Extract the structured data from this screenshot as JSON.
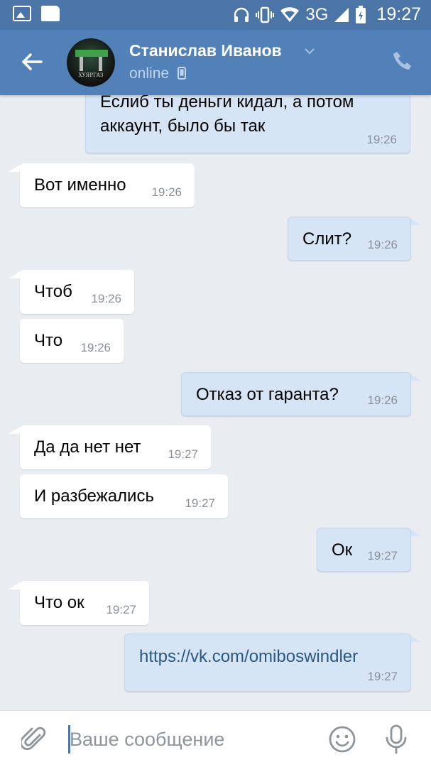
{
  "status_bar": {
    "time": "19:27",
    "network": "3G",
    "icons": [
      "image-icon",
      "document-icon",
      "headphones-icon",
      "vibrate-icon",
      "wifi-icon",
      "signal-icon",
      "battery-charging-icon"
    ]
  },
  "header": {
    "contact_name": "Станислав Иванов",
    "status": "online",
    "icons": [
      "back-arrow-icon",
      "avatar",
      "chevron-down-icon",
      "mobile-icon",
      "phone-icon"
    ]
  },
  "messages": [
    {
      "dir": "out",
      "text": "Еслиб ты деньги кидал, а потом\nаккаунт, было бы так",
      "time": "19:26"
    },
    {
      "dir": "in",
      "text": "Вот именно",
      "time": "19:26"
    },
    {
      "dir": "out",
      "text": "Слит?",
      "time": "19:26"
    },
    {
      "dir": "in",
      "text": "Чтоб",
      "time": "19:26"
    },
    {
      "dir": "in",
      "text": "Что",
      "time": "19:26"
    },
    {
      "dir": "out",
      "text": "Отказ от гаранта?",
      "time": "19:26"
    },
    {
      "dir": "in",
      "text": "Да да нет нет",
      "time": "19:27"
    },
    {
      "dir": "in",
      "text": "И разбежались",
      "time": "19:27"
    },
    {
      "dir": "out",
      "text": "Ок",
      "time": "19:27"
    },
    {
      "dir": "in",
      "text": "Что ок",
      "time": "19:27"
    },
    {
      "dir": "out",
      "text": "https://vk.com/omiboswindler",
      "time": "19:27",
      "link": true
    }
  ],
  "composer": {
    "placeholder": "Ваше сообщение",
    "icons": [
      "paperclip-icon",
      "smile-icon",
      "microphone-icon"
    ]
  },
  "colors": {
    "header": "#5181b8",
    "status_bar": "#4a75a6",
    "chat_bg": "#e9edf2",
    "incoming_bubble": "#ffffff",
    "outgoing_bubble": "#d6e5f6",
    "link": "#2a5885"
  }
}
